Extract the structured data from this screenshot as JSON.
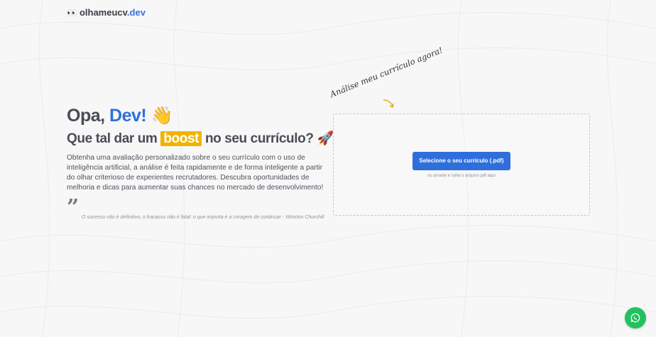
{
  "header": {
    "logo_icon": "👀",
    "brand_main": "olhameucv",
    "brand_suffix": ".dev"
  },
  "hero": {
    "greeting": "Opa,",
    "greeting_accent": "Dev!",
    "greeting_emoji": "👋",
    "headline_prefix": "Que tal dar um",
    "headline_highlight": "boost",
    "headline_suffix": "no seu currículo?",
    "headline_emoji": "🚀",
    "description": "Obtenha uma avaliação personalizado sobre o seu currículo com o uso de inteligência artificial, a análise é feita rapidamente e de forma inteligente a partir do olhar criterioso de experientes recrutadores. Descubra oportunidades de melhoria e dicas para aumentar suas chances no mercado de desenvolvimento!",
    "quote_icon": "quote-icon",
    "quote": "O sucesso não é definitivo, o fracasso não é fatal: o que importa é a coragem de continuar - Winston Churchill"
  },
  "upload": {
    "handwritten": "Análise meu currículo agora!",
    "button_label": "Selecione o seu currículo (.pdf)",
    "hint": "ou arraste e solte o arquivo pdf aqui"
  },
  "chat": {
    "icon": "chat-bubble-icon"
  },
  "colors": {
    "accent": "#2f6fdc",
    "highlight": "#f0b400",
    "chat": "#22c15e"
  }
}
